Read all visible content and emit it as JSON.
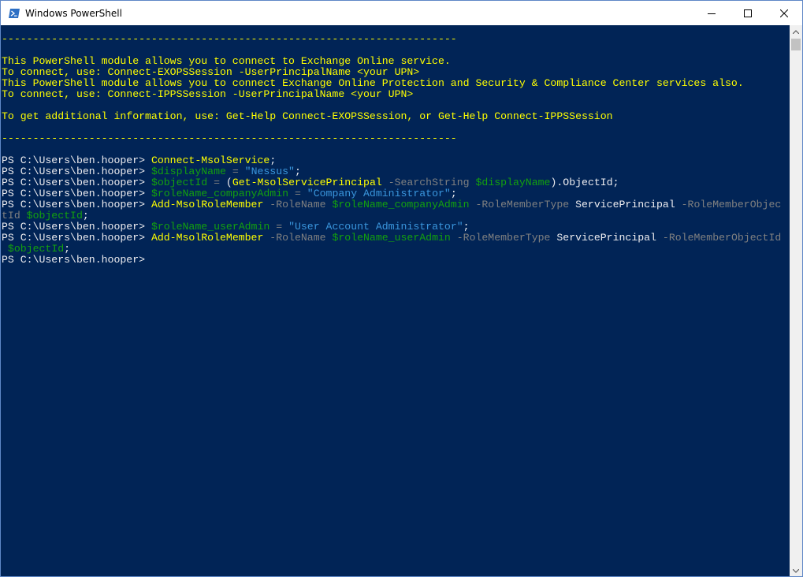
{
  "window": {
    "title": "Windows PowerShell",
    "icon": "powershell-icon",
    "controls": [
      "minimize-icon",
      "maximize-icon",
      "close-icon"
    ]
  },
  "colors": {
    "background": "#012456",
    "default_text": "#eeedf0",
    "banner_text": "#ffff00",
    "command": "#ffff00",
    "variable": "#13a10e",
    "string": "#3a96dd",
    "parameter": "#808080",
    "operator": "#808080"
  },
  "console": {
    "lines": [
      [
        {
          "t": "-------------------------------------------------------------------------",
          "c": "banner"
        }
      ],
      [],
      [
        {
          "t": "This PowerShell module allows you to connect to Exchange Online service.",
          "c": "banner"
        }
      ],
      [
        {
          "t": "To connect, use: Connect-EXOPSSession -UserPrincipalName <your UPN>",
          "c": "banner"
        }
      ],
      [
        {
          "t": "This PowerShell module allows you to connect Exchange Online Protection and Security & Compliance Center services also.",
          "c": "banner"
        }
      ],
      [
        {
          "t": "To connect, use: Connect-IPPSSession -UserPrincipalName <your UPN>",
          "c": "banner"
        }
      ],
      [],
      [
        {
          "t": "To get additional information, use: Get-Help Connect-EXOPSSession, or Get-Help Connect-IPPSSession",
          "c": "banner"
        }
      ],
      [],
      [
        {
          "t": "-------------------------------------------------------------------------",
          "c": "banner"
        }
      ],
      [],
      [
        {
          "t": "PS C:\\Users\\ben.hooper> ",
          "c": "default"
        },
        {
          "t": "Connect-MsolService",
          "c": "command"
        },
        {
          "t": ";",
          "c": "default"
        }
      ],
      [
        {
          "t": "PS C:\\Users\\ben.hooper> ",
          "c": "default"
        },
        {
          "t": "$displayName",
          "c": "variable"
        },
        {
          "t": " = ",
          "c": "operator"
        },
        {
          "t": "\"Nessus\"",
          "c": "string"
        },
        {
          "t": ";",
          "c": "default"
        }
      ],
      [
        {
          "t": "PS C:\\Users\\ben.hooper> ",
          "c": "default"
        },
        {
          "t": "$objectId",
          "c": "variable"
        },
        {
          "t": " = ",
          "c": "operator"
        },
        {
          "t": "(",
          "c": "default"
        },
        {
          "t": "Get-MsolServicePrincipal",
          "c": "command"
        },
        {
          "t": " -SearchString ",
          "c": "parameter"
        },
        {
          "t": "$displayName",
          "c": "variable"
        },
        {
          "t": ").ObjectId;",
          "c": "default"
        }
      ],
      [
        {
          "t": "PS C:\\Users\\ben.hooper> ",
          "c": "default"
        },
        {
          "t": "$roleName_companyAdmin",
          "c": "variable"
        },
        {
          "t": " = ",
          "c": "operator"
        },
        {
          "t": "\"Company Administrator\"",
          "c": "string"
        },
        {
          "t": ";",
          "c": "default"
        }
      ],
      [
        {
          "t": "PS C:\\Users\\ben.hooper> ",
          "c": "default"
        },
        {
          "t": "Add-MsolRoleMember",
          "c": "command"
        },
        {
          "t": " -RoleName ",
          "c": "parameter"
        },
        {
          "t": "$roleName_companyAdmin",
          "c": "variable"
        },
        {
          "t": " -RoleMemberType ",
          "c": "parameter"
        },
        {
          "t": "ServicePrincipal",
          "c": "default"
        },
        {
          "t": " -RoleMemberObjec",
          "c": "parameter"
        }
      ],
      [
        {
          "t": "tId ",
          "c": "parameter"
        },
        {
          "t": "$objectId",
          "c": "variable"
        },
        {
          "t": ";",
          "c": "default"
        }
      ],
      [
        {
          "t": "PS C:\\Users\\ben.hooper> ",
          "c": "default"
        },
        {
          "t": "$roleName_userAdmin",
          "c": "variable"
        },
        {
          "t": " = ",
          "c": "operator"
        },
        {
          "t": "\"User Account Administrator\"",
          "c": "string"
        },
        {
          "t": ";",
          "c": "default"
        }
      ],
      [
        {
          "t": "PS C:\\Users\\ben.hooper> ",
          "c": "default"
        },
        {
          "t": "Add-MsolRoleMember",
          "c": "command"
        },
        {
          "t": " -RoleName ",
          "c": "parameter"
        },
        {
          "t": "$roleName_userAdmin",
          "c": "variable"
        },
        {
          "t": " -RoleMemberType ",
          "c": "parameter"
        },
        {
          "t": "ServicePrincipal",
          "c": "default"
        },
        {
          "t": " -RoleMemberObjectId",
          "c": "parameter"
        }
      ],
      [
        {
          "t": " ",
          "c": "default"
        },
        {
          "t": "$objectId",
          "c": "variable"
        },
        {
          "t": ";",
          "c": "default"
        }
      ],
      [
        {
          "t": "PS C:\\Users\\ben.hooper>",
          "c": "default"
        }
      ]
    ]
  }
}
